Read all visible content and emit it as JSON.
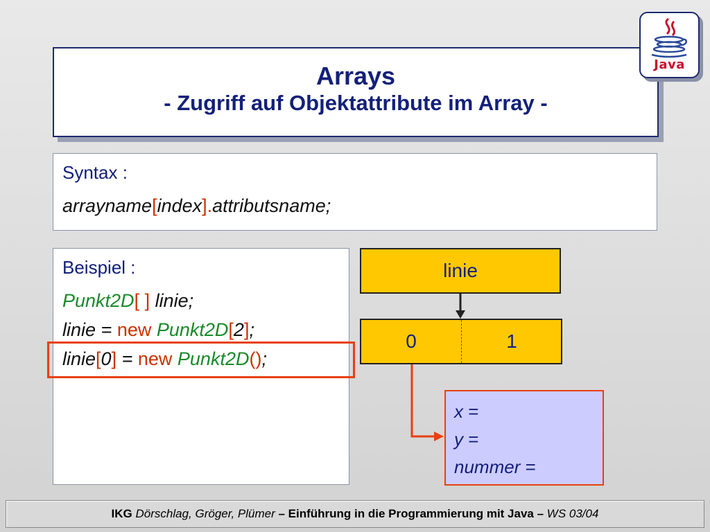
{
  "title": {
    "line1": "Arrays",
    "line2": "- Zugriff auf Objektattribute im Array -"
  },
  "logo": {
    "text": "Java"
  },
  "syntax": {
    "label": "Syntax :",
    "arrayname": "arrayname",
    "open_bracket": "[",
    "index": "index",
    "close_bracket_dot": "].",
    "attribut": "attributsname;"
  },
  "example": {
    "label": "Beispiel :",
    "line1": {
      "type": "Punkt2D",
      "brackets": "[ ]",
      "rest": " linie;"
    },
    "line2": {
      "lhs": "linie = ",
      "new": "new",
      "type": " Punkt2D",
      "open": "[",
      "num": "2",
      "close": "]",
      "end": ";"
    },
    "line3": {
      "lhs": "linie",
      "open": "[",
      "num": "0",
      "close": "]",
      "eq": " = ",
      "new": "new",
      "type": " Punkt2D",
      "parens": "()",
      "end": ";"
    }
  },
  "diagram": {
    "ref_label": "linie",
    "cells": [
      "0",
      "1"
    ],
    "object_fields": [
      {
        "name": "x",
        "eq": " ="
      },
      {
        "name": "y",
        "eq": " ="
      },
      {
        "name": "nummer",
        "eq": " ="
      }
    ]
  },
  "footer": {
    "ikg": "IKG",
    "authors": " Dörschlag, Gröger, Plümer",
    "course": " – Einführung in die Programmierung mit Java – ",
    "term": "WS 03/04"
  },
  "colors": {
    "title_blue": "#13207a",
    "highlight_red": "#e84010",
    "array_yellow": "#ffc800",
    "object_lavender": "#ccccff",
    "code_green": "#1a8a2a",
    "code_red": "#cc3300"
  }
}
